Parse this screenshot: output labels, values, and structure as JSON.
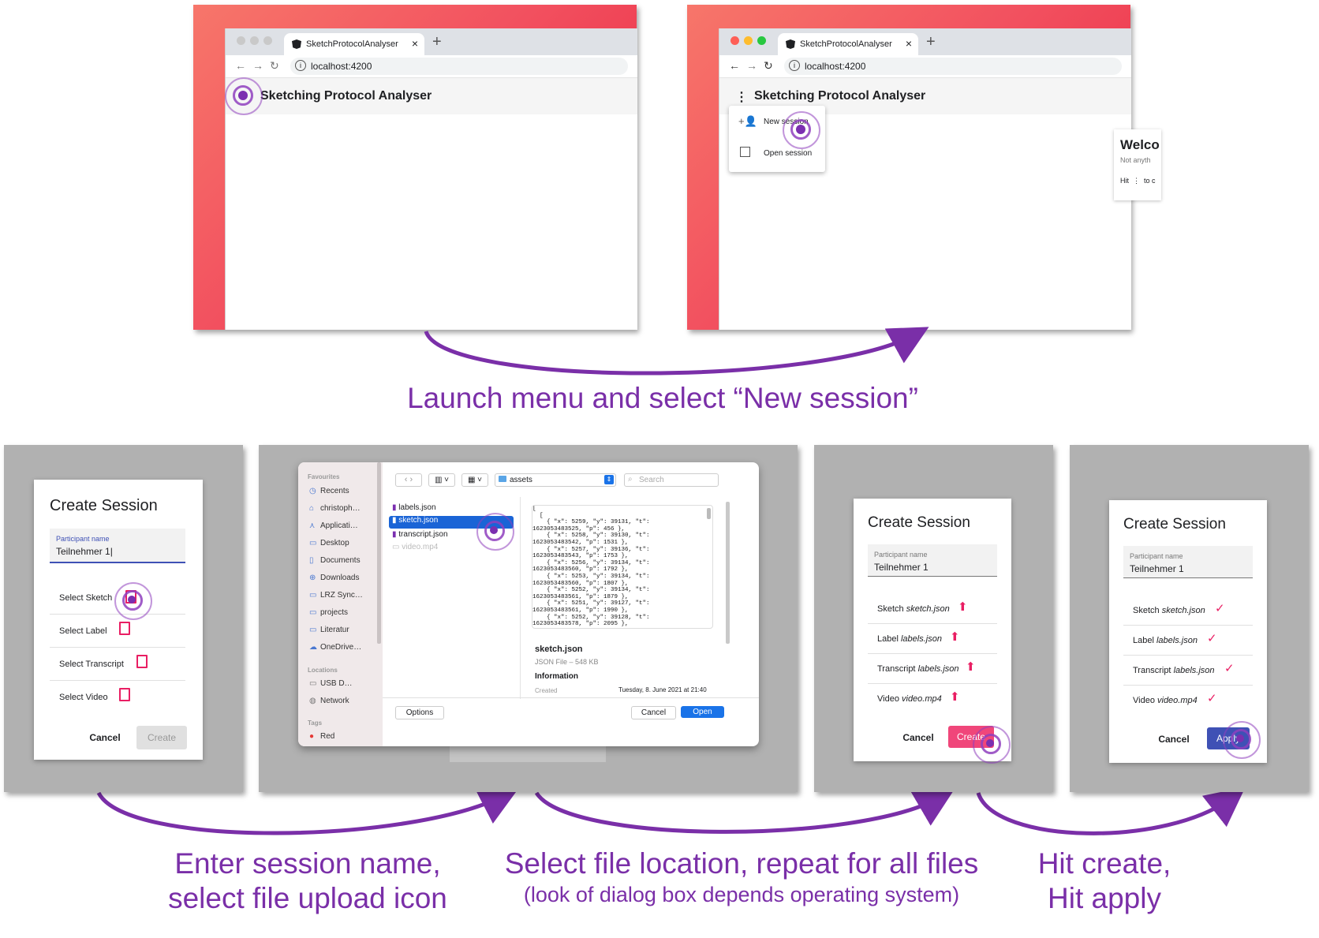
{
  "browser": {
    "tab_title": "SketchProtocolAnalyser",
    "tab_close": "×",
    "new_tab": "+",
    "url": "localhost:4200",
    "app_title": "Sketching Protocol Analyser",
    "menu_icon": "⋮"
  },
  "menu": {
    "new_session": "New session",
    "open_session": "Open session"
  },
  "welcome_card": {
    "title": "Welco",
    "line1": "Not anyth",
    "line2": "Hit  ⋮  to c"
  },
  "captions": {
    "step1": "Launch menu and select “New session”",
    "step2_line1": "Enter session name,",
    "step2_line2": "select file upload icon",
    "step3_line1": "Select file location, repeat for all files",
    "step3_line2": "(look of dialog box depends operating system)",
    "step4_line1": "Hit create,",
    "step4_line2": "Hit apply"
  },
  "dialog1": {
    "title": "Create Session",
    "participant_label": "Participant name",
    "participant_value": "Teilnehmer 1|",
    "select_sketch": "Select Sketch",
    "select_label": "Select Label",
    "select_transcript": "Select Transcript",
    "select_video": "Select Video",
    "cancel": "Cancel",
    "create": "Create"
  },
  "finder": {
    "favourites": "Favourites",
    "sidebar_items": [
      "Recents",
      "christoph…",
      "Applicati…",
      "Desktop",
      "Documents",
      "Downloads",
      "LRZ Sync…",
      "projects",
      "Literatur",
      "OneDrive…"
    ],
    "locations": "Locations",
    "location_items": [
      "USB D…",
      "Network"
    ],
    "tags": "Tags",
    "tag_red": "Red",
    "folder": "assets",
    "search_placeholder": "Search",
    "files": [
      "labels.json",
      "sketch.json",
      "transcript.json",
      "video.mp4"
    ],
    "json_preview": "[\n  [\n    { \"x\": 5259, \"y\": 39131, \"t\":\n1623053483525, \"p\": 456 },\n    { \"x\": 5258, \"y\": 39130, \"t\":\n1623053483542, \"p\": 1531 },\n    { \"x\": 5257, \"y\": 39136, \"t\":\n1623053483543, \"p\": 1753 },\n    { \"x\": 5256, \"y\": 39134, \"t\":\n1623053483560, \"p\": 1792 },\n    { \"x\": 5253, \"y\": 39134, \"t\":\n1623053483560, \"p\": 1807 },\n    { \"x\": 5252, \"y\": 39134, \"t\":\n1623053483561, \"p\": 1879 },\n    { \"x\": 5251, \"y\": 39127, \"t\":\n1623053483561, \"p\": 1990 },\n    { \"x\": 5252, \"y\": 39128, \"t\":\n1623053483578, \"p\": 2095 },",
    "preview_name": "sketch.json",
    "preview_meta": "JSON File – 548 KB",
    "information": "Information",
    "created_label": "Created",
    "created_value": "Tuesday, 8. June 2021 at 21:40",
    "options": "Options",
    "cancel": "Cancel",
    "open": "Open"
  },
  "dialog3": {
    "title": "Create Session",
    "participant_label": "Participant name",
    "participant_value": "Teilnehmer 1",
    "rows": [
      {
        "label": "Sketch",
        "file": "sketch.json"
      },
      {
        "label": "Label",
        "file": "labels.json"
      },
      {
        "label": "Transcript",
        "file": "labels.json"
      },
      {
        "label": "Video",
        "file": "video.mp4"
      }
    ],
    "cancel": "Cancel",
    "create": "Create"
  },
  "dialog4": {
    "title": "Create Session",
    "participant_label": "Participant name",
    "participant_value": "Teilnehmer 1",
    "rows": [
      {
        "label": "Sketch",
        "file": "sketch.json"
      },
      {
        "label": "Label",
        "file": "labels.json"
      },
      {
        "label": "Transcript",
        "file": "labels.json"
      },
      {
        "label": "Video",
        "file": "video.mp4"
      }
    ],
    "cancel": "Cancel",
    "apply": "Apply"
  },
  "colors": {
    "caption": "#7a2fa8",
    "arrow": "#7a2fa8",
    "create_button": "#f0467a",
    "apply_button": "#3f51b5",
    "open_button": "#1a73e8",
    "upload_icon": "#e91e63"
  }
}
